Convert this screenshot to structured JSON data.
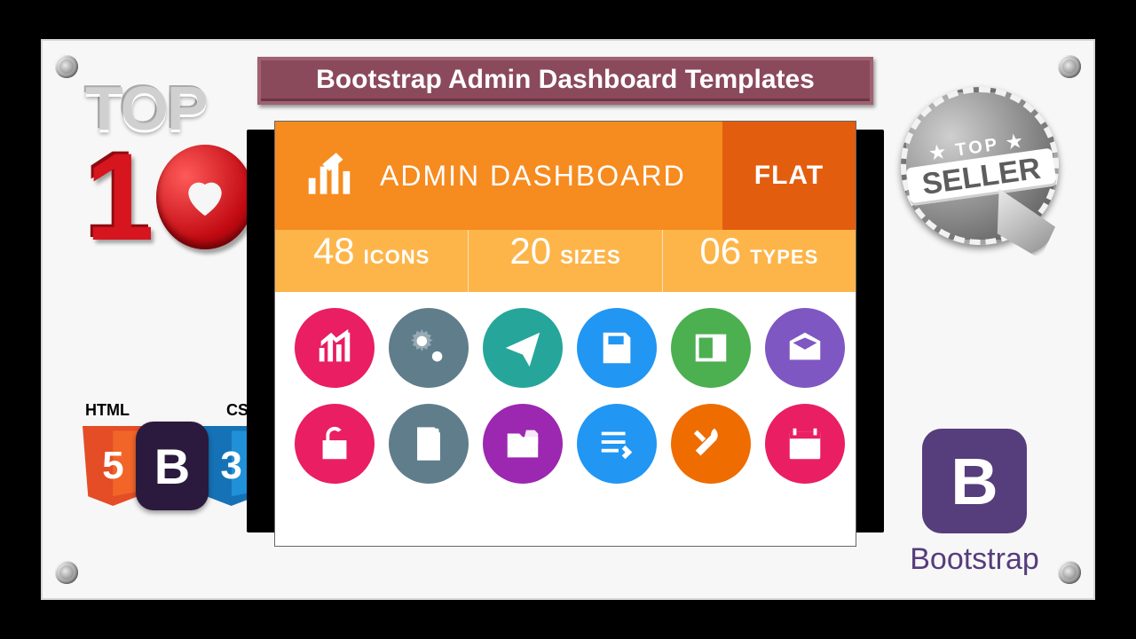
{
  "title": "Bootstrap Admin Dashboard Templates",
  "top10": {
    "label": "TOP",
    "number_one": "1"
  },
  "tech": {
    "html_label": "HTML",
    "css_label": "CSS",
    "html_ver": "5",
    "css_ver": "3",
    "b": "B"
  },
  "seal": {
    "top_label": "★ TOP ★",
    "word": "SELLER"
  },
  "bootstrap": {
    "letter": "B",
    "name": "Bootstrap"
  },
  "card": {
    "header_text": "ADMIN DASHBOARD",
    "flat_label": "FLAT",
    "stats": [
      {
        "n": "48",
        "l": "ICONS"
      },
      {
        "n": "20",
        "l": "SIZES"
      },
      {
        "n": "06",
        "l": "TYPES"
      }
    ],
    "icons": [
      {
        "name": "chart-icon",
        "color": "c-pink"
      },
      {
        "name": "gears-icon",
        "color": "c-slate"
      },
      {
        "name": "paper-plane-icon",
        "color": "c-teal"
      },
      {
        "name": "save-icon",
        "color": "c-blue"
      },
      {
        "name": "news-icon",
        "color": "c-green"
      },
      {
        "name": "envelope-open-icon",
        "color": "c-violet"
      },
      {
        "name": "unlock-icon",
        "color": "c-pink"
      },
      {
        "name": "documents-icon",
        "color": "c-slate"
      },
      {
        "name": "folder-file-icon",
        "color": "c-purple"
      },
      {
        "name": "list-edit-icon",
        "color": "c-blue"
      },
      {
        "name": "tools-icon",
        "color": "c-orange"
      },
      {
        "name": "calendar-icon",
        "color": "c-pink"
      }
    ]
  }
}
